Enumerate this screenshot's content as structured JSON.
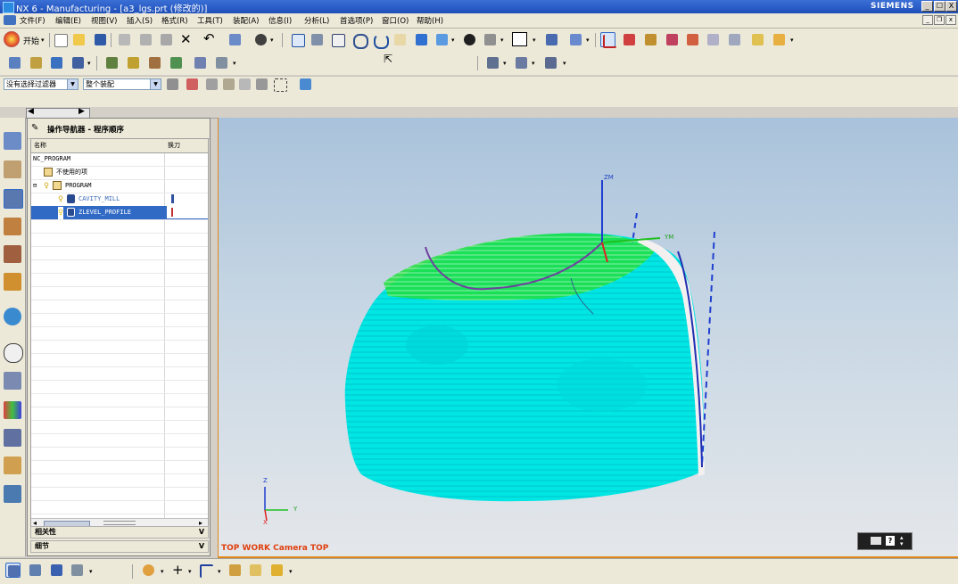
{
  "window": {
    "title": "NX 6 - Manufacturing - [a3_lgs.prt (修改的)]",
    "brand": "SIEMENS",
    "controls": {
      "minimize": "_",
      "maximize": "☐",
      "close": "X"
    }
  },
  "menu": {
    "items": [
      "文件(F)",
      "编辑(E)",
      "视图(V)",
      "插入(S)",
      "格式(R)",
      "工具(T)",
      "装配(A)",
      "信息(I)",
      "分析(L)",
      "首选项(P)",
      "窗口(O)",
      "帮助(H)"
    ]
  },
  "toolbar": {
    "start_label": "开始"
  },
  "filter": {
    "selection_filter": "没有选择过滤器",
    "scope": "整个装配"
  },
  "navigator": {
    "title": "操作导航器 - 程序顺序",
    "columns": {
      "name": "名称",
      "tool_change": "换刀"
    },
    "rows": [
      {
        "name": "NC_PROGRAM",
        "indent": 0
      },
      {
        "name": "不使用的项",
        "indent": 1
      },
      {
        "name": "PROGRAM",
        "indent": 1
      },
      {
        "name": "CAVITY_MILL",
        "indent": 2
      },
      {
        "name": "ZLEVEL_PROFILE",
        "indent": 2,
        "selected": true
      }
    ],
    "panels": {
      "dependencies": "相关性",
      "details": "细节"
    }
  },
  "viewport": {
    "view_label": "TOP WORK Camera TOP",
    "axis_labels": {
      "zm": "ZM",
      "ym": "YM",
      "z": "Z",
      "y": "Y",
      "x": "X"
    }
  },
  "colors": {
    "toolpath_cyan": "#00e8e0",
    "toolpath_green": "#22e030",
    "selection_blue": "#316ac5",
    "accent_orange": "#e0891a"
  }
}
